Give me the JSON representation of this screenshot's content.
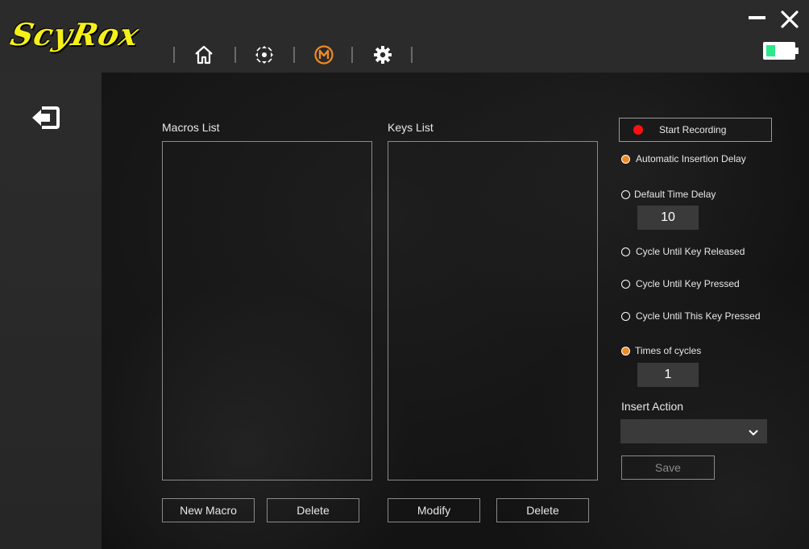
{
  "app": {
    "logo_text": "ScyRox"
  },
  "nav": {
    "icons": [
      "home-icon",
      "dpad-icon",
      "macro-icon",
      "gear-icon"
    ],
    "active": "macro-icon",
    "accent": "#f08a24"
  },
  "battery": {
    "level": 0.35,
    "color": "#2ee88a"
  },
  "macros": {
    "title": "Macros List",
    "items": []
  },
  "keys": {
    "title": "Keys List",
    "items": []
  },
  "buttons": {
    "new_macro": "New Macro",
    "delete_macro": "Delete",
    "modify": "Modify",
    "delete_key": "Delete",
    "start_recording": "Start Recording",
    "save": "Save"
  },
  "options": {
    "auto_insertion_delay": "Automatic Insertion Delay",
    "default_time_delay": "Default Time Delay",
    "default_time_delay_value": "10",
    "cycle_until_released": "Cycle Until Key Released",
    "cycle_until_pressed": "Cycle Until Key Pressed",
    "cycle_until_this_pressed": "Cycle Until This Key Pressed",
    "times_of_cycles": "Times of cycles",
    "times_of_cycles_value": "1"
  },
  "insert_action": {
    "label": "Insert Action",
    "selected": ""
  }
}
